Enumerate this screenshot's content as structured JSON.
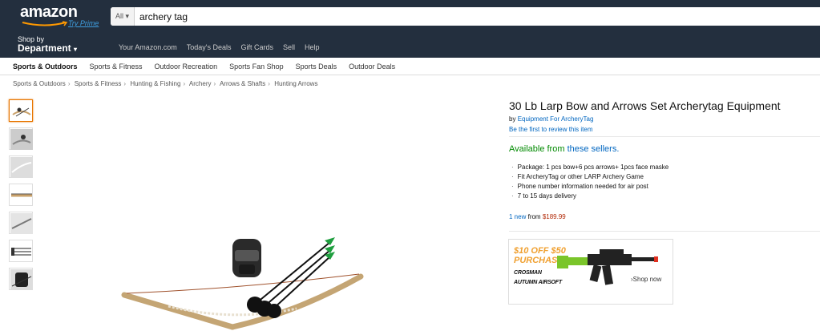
{
  "header": {
    "logo_text": "amazon",
    "logo_sub": "Try Prime",
    "search_category": "All",
    "search_value": "archery tag"
  },
  "nav": {
    "shop_by_small": "Shop by",
    "shop_by_big": "Department",
    "links": [
      "Your Amazon.com",
      "Today's Deals",
      "Gift Cards",
      "Sell",
      "Help"
    ]
  },
  "subnav": {
    "items": [
      "Sports & Outdoors",
      "Sports & Fitness",
      "Outdoor Recreation",
      "Sports Fan Shop",
      "Sports Deals",
      "Outdoor Deals"
    ]
  },
  "breadcrumb": [
    "Sports & Outdoors",
    "Sports & Fitness",
    "Hunting & Fishing",
    "Archery",
    "Arrows & Shafts",
    "Hunting Arrows"
  ],
  "product": {
    "title": "30 Lb Larp Bow and Arrows Set Archerytag Equipment",
    "by_prefix": "by",
    "brand": "Equipment For ArcheryTag",
    "review_link": "Be the first to review this item",
    "avail_prefix": "Available from",
    "avail_link": "these sellers.",
    "bullets": [
      "Package: 1 pcs bow+6 pcs arrows+ 1pcs face maske",
      "Fit ArcheryTag or other LARP Archery Game",
      "Phone number information needed for air post",
      "7 to 15 days delivery"
    ],
    "offers_new": "1 new",
    "offers_from": "from",
    "offers_price": "$189.99"
  },
  "ad": {
    "line1": "$10 OFF $50",
    "line2": "PURCHASE",
    "line3": "CROSMAN",
    "line4": "AUTUMN AIRSOFT",
    "shop": "›Shop now"
  },
  "thumbnails": [
    "bow-set",
    "bow-mask",
    "bow-plain",
    "bow-side",
    "bow-curved",
    "arrows",
    "mask"
  ],
  "colors": {
    "header_bg": "#232f3e",
    "link": "#0066c0",
    "available": "#008a00",
    "price": "#b12704",
    "ad_accent": "#f0a030"
  }
}
